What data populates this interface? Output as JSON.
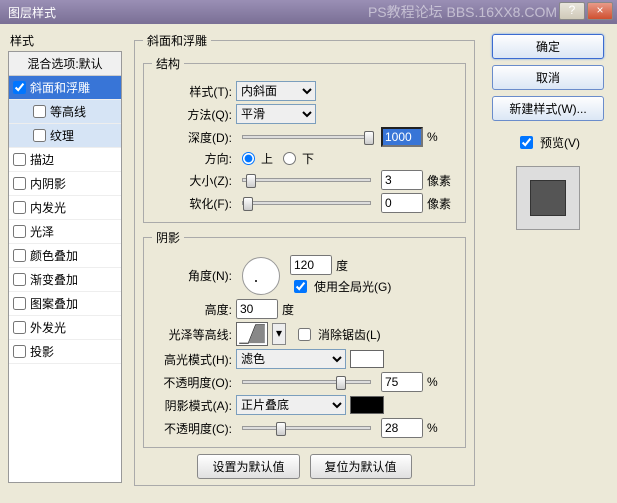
{
  "window": {
    "title": "图层样式",
    "watermark": "PS教程论坛 BBS.16XX8.COM"
  },
  "styles": {
    "header": "样式",
    "blend": "混合选项:默认",
    "items": [
      {
        "label": "斜面和浮雕",
        "checked": true,
        "sel": true
      },
      {
        "label": "等高线",
        "checked": false,
        "sub": true
      },
      {
        "label": "纹理",
        "checked": false,
        "sub": true
      },
      {
        "label": "描边",
        "checked": false
      },
      {
        "label": "内阴影",
        "checked": false
      },
      {
        "label": "内发光",
        "checked": false
      },
      {
        "label": "光泽",
        "checked": false
      },
      {
        "label": "颜色叠加",
        "checked": false
      },
      {
        "label": "渐变叠加",
        "checked": false
      },
      {
        "label": "图案叠加",
        "checked": false
      },
      {
        "label": "外发光",
        "checked": false
      },
      {
        "label": "投影",
        "checked": false
      }
    ]
  },
  "bevel": {
    "group": "斜面和浮雕",
    "struct": "结构",
    "style_l": "样式(T):",
    "style_v": "内斜面",
    "tech_l": "方法(Q):",
    "tech_v": "平滑",
    "depth_l": "深度(D):",
    "depth_v": "1000",
    "pct": "%",
    "dir_l": "方向:",
    "up": "上",
    "down": "下",
    "size_l": "大小(Z):",
    "size_v": "3",
    "px": "像素",
    "soft_l": "软化(F):",
    "soft_v": "0"
  },
  "shade": {
    "group": "阴影",
    "angle_l": "角度(N):",
    "angle_v": "120",
    "deg": "度",
    "global": "使用全局光(G)",
    "alt_l": "高度:",
    "alt_v": "30",
    "gloss_l": "光泽等高线:",
    "aa": "消除锯齿(L)",
    "hmode_l": "高光模式(H):",
    "hmode_v": "滤色",
    "hcolor": "#ffffff",
    "hopac_l": "不透明度(O):",
    "hopac_v": "75",
    "smode_l": "阴影模式(A):",
    "smode_v": "正片叠底",
    "scolor": "#000000",
    "sopac_l": "不透明度(C):",
    "sopac_v": "28"
  },
  "buttons": {
    "def": "设置为默认值",
    "reset": "复位为默认值"
  },
  "right": {
    "ok": "确定",
    "cancel": "取消",
    "newstyle": "新建样式(W)...",
    "preview": "预览(V)"
  }
}
